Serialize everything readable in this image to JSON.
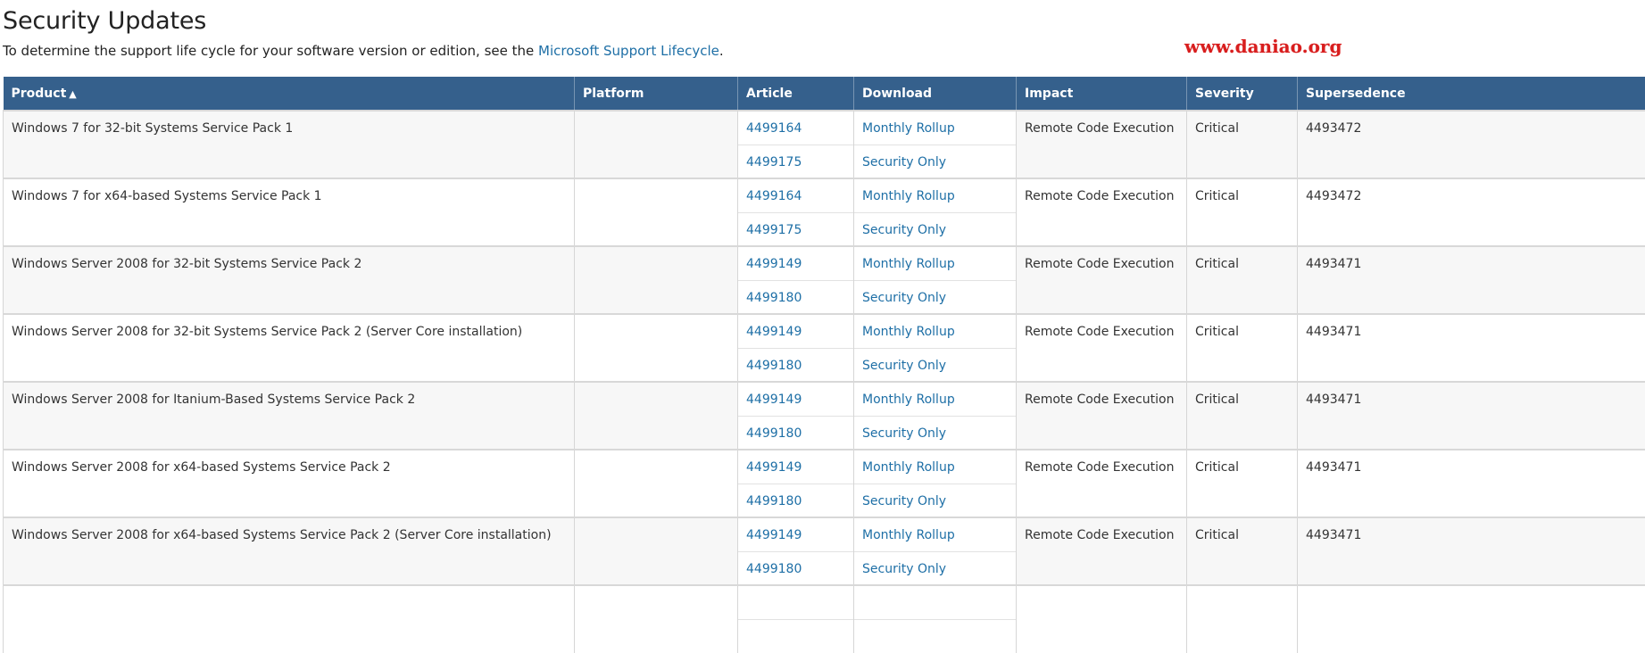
{
  "header": {
    "title": "Security Updates",
    "intro_text": "To determine the support life cycle for your software version or edition, see the ",
    "intro_link": "Microsoft Support Lifecycle",
    "intro_end": "."
  },
  "watermark": "www.daniao.org",
  "table": {
    "columns": [
      "Product",
      "Platform",
      "Article",
      "Download",
      "Impact",
      "Severity",
      "Supersedence"
    ],
    "sort_indicator": "▲",
    "rows": [
      {
        "product": "Windows 7 for 32-bit Systems Service Pack 1",
        "platform": "",
        "article1": "4499164",
        "download1": "Monthly Rollup",
        "article2": "4499175",
        "download2": "Security Only",
        "impact": "Remote Code Execution",
        "severity": "Critical",
        "supersedence": "4493472"
      },
      {
        "product": "Windows 7 for x64-based Systems Service Pack 1",
        "platform": "",
        "article1": "4499164",
        "download1": "Monthly Rollup",
        "article2": "4499175",
        "download2": "Security Only",
        "impact": "Remote Code Execution",
        "severity": "Critical",
        "supersedence": "4493472"
      },
      {
        "product": "Windows Server 2008 for 32-bit Systems Service Pack 2",
        "platform": "",
        "article1": "4499149",
        "download1": "Monthly Rollup",
        "article2": "4499180",
        "download2": "Security Only",
        "impact": "Remote Code Execution",
        "severity": "Critical",
        "supersedence": "4493471"
      },
      {
        "product": "Windows Server 2008 for 32-bit Systems Service Pack 2 (Server Core installation)",
        "platform": "",
        "article1": "4499149",
        "download1": "Monthly Rollup",
        "article2": "4499180",
        "download2": "Security Only",
        "impact": "Remote Code Execution",
        "severity": "Critical",
        "supersedence": "4493471"
      },
      {
        "product": "Windows Server 2008 for Itanium-Based Systems Service Pack 2",
        "platform": "",
        "article1": "4499149",
        "download1": "Monthly Rollup",
        "article2": "4499180",
        "download2": "Security Only",
        "impact": "Remote Code Execution",
        "severity": "Critical",
        "supersedence": "4493471"
      },
      {
        "product": "Windows Server 2008 for x64-based Systems Service Pack 2",
        "platform": "",
        "article1": "4499149",
        "download1": "Monthly Rollup",
        "article2": "4499180",
        "download2": "Security Only",
        "impact": "Remote Code Execution",
        "severity": "Critical",
        "supersedence": "4493471"
      },
      {
        "product": "Windows Server 2008 for x64-based Systems Service Pack 2 (Server Core installation)",
        "platform": "",
        "article1": "4499149",
        "download1": "Monthly Rollup",
        "article2": "4499180",
        "download2": "Security Only",
        "impact": "Remote Code Execution",
        "severity": "Critical",
        "supersedence": "4493471"
      },
      {
        "product": "",
        "platform": "",
        "article1": "",
        "download1": "",
        "article2": "",
        "download2": "",
        "impact": "",
        "severity": "",
        "supersedence": ""
      }
    ]
  },
  "colors": {
    "header_bg": "#35608c",
    "link": "#1e6fa6",
    "watermark": "#d81e1e"
  }
}
